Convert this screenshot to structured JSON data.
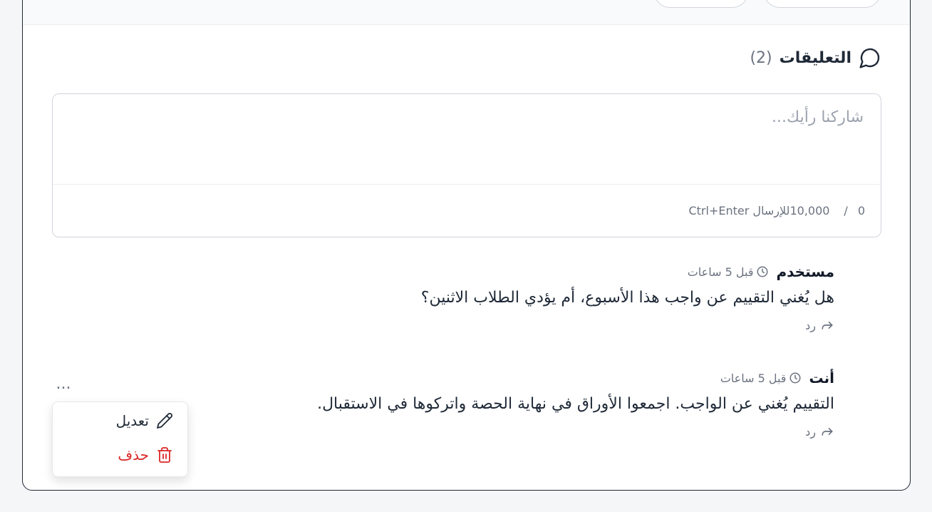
{
  "comments_section": {
    "title": "التعليقات",
    "count": "(2)"
  },
  "composer": {
    "placeholder": "شاركنا رأيك...",
    "value": "",
    "char_count": "0",
    "separator": "/",
    "char_limit": "10,000",
    "shortcut_hint": "Ctrl+Enter للإرسال"
  },
  "comments": [
    {
      "author": "مستخدم",
      "time": "قبل 5 ساعات",
      "body": "هل يُغني التقييم عن واجب هذا الأسبوع، أم يؤدي الطلاب الاثنين؟",
      "reply_label": "رد"
    },
    {
      "author": "أنت",
      "time": "قبل 5 ساعات",
      "body": "التقييم يُغني عن الواجب. اجمعوا الأوراق في نهاية الحصة واتركوها في الاستقبال.",
      "reply_label": "رد"
    }
  ],
  "more_menu": {
    "trigger_label": "...",
    "edit_label": "تعديل",
    "delete_label": "حذف"
  },
  "colors": {
    "danger": "#dc2626",
    "muted": "#6b7280",
    "border": "#d1d5db"
  }
}
